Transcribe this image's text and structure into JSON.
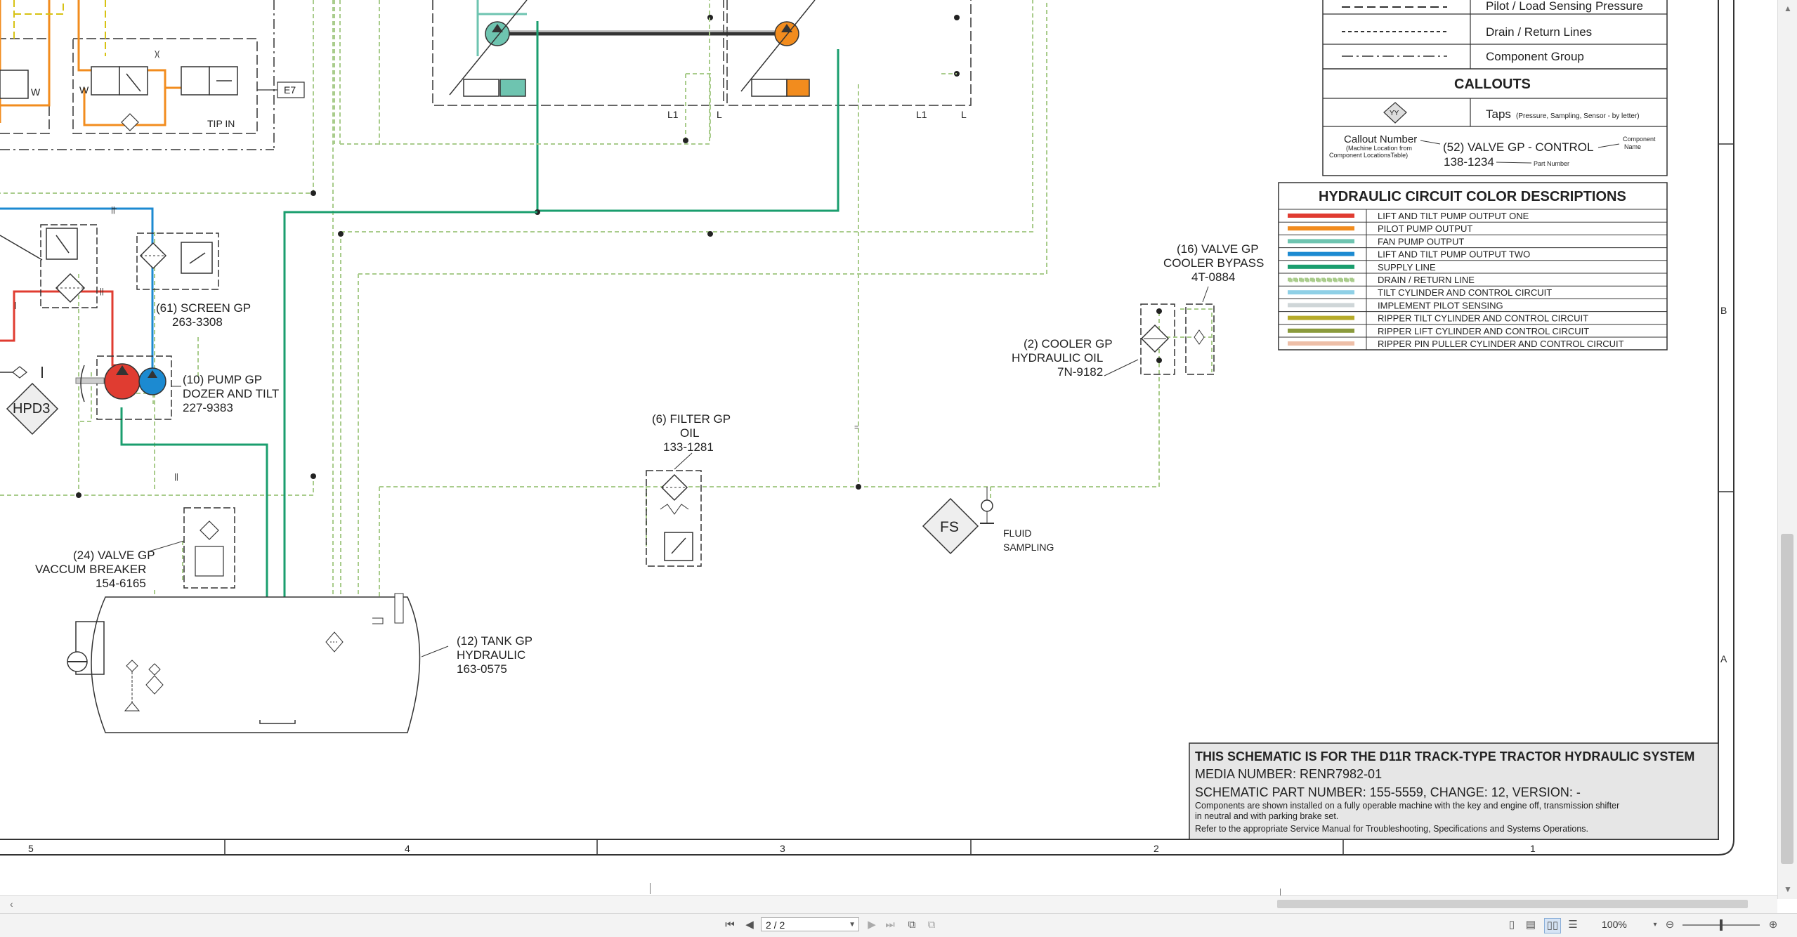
{
  "legend": {
    "line_types": [
      "Pilot / Load Sensing Pressure",
      "Drain / Return Lines",
      "Component Group"
    ],
    "callouts_title": "CALLOUTS",
    "tap_symbol": "YY",
    "taps_label": "Taps",
    "taps_note": "(Pressure, Sampling, Sensor - by letter)",
    "callout_number_label": "Callout Number",
    "callout_number_note": "(Machine Location from",
    "callout_number_note2": "Component LocationsTable)",
    "example_callout": "(52) VALVE GP - CONTROL",
    "component_name_label": "Component",
    "component_name_label2": "Name",
    "example_part": "138-1234",
    "part_number_label": "Part Number"
  },
  "color_legend": {
    "title": "HYDRAULIC CIRCUIT COLOR DESCRIPTIONS",
    "items": [
      {
        "label": "LIFT AND TILT PUMP OUTPUT ONE",
        "color": "#e03c31"
      },
      {
        "label": "PILOT PUMP OUTPUT",
        "color": "#f28c1e"
      },
      {
        "label": "FAN PUMP OUTPUT",
        "color": "#6ec4b0"
      },
      {
        "label": "LIFT AND TILT PUMP OUTPUT TWO",
        "color": "#1c8ad1"
      },
      {
        "label": "SUPPLY LINE",
        "color": "#1a9e6e"
      },
      {
        "label": "DRAIN / RETURN LINE",
        "color": "#a9cc8c"
      },
      {
        "label": "TILT CYLINDER AND CONTROL CIRCUIT",
        "color": "#8fd0e6"
      },
      {
        "label": "IMPLEMENT PILOT SENSING",
        "color": "#cfd6d8"
      },
      {
        "label": "RIPPER TILT CYLINDER AND CONTROL CIRCUIT",
        "color": "#b6ab2a"
      },
      {
        "label": "RIPPER LIFT CYLINDER AND CONTROL CIRCUIT",
        "color": "#8a9a3c"
      },
      {
        "label": "RIPPER PIN PULLER CYLINDER AND CONTROL CIRCUIT",
        "color": "#eebfa8"
      }
    ]
  },
  "components": {
    "valve16": [
      "(16) VALVE GP",
      "COOLER BYPASS",
      "4T-0884"
    ],
    "cooler2": [
      "(2) COOLER GP",
      "HYDRAULIC OIL",
      "7N-9182"
    ],
    "screen61": [
      "(61) SCREEN GP",
      "263-3308"
    ],
    "pump10": [
      "(10) PUMP GP",
      "DOZER AND TILT",
      "227-9383"
    ],
    "filter6": [
      "(6) FILTER GP",
      "OIL",
      "133-1281"
    ],
    "valve24": [
      "(24) VALVE GP",
      "VACCUM BREAKER",
      "154-6165"
    ],
    "tank12": [
      "(12) TANK GP",
      "HYDRAULIC",
      "163-0575"
    ],
    "fluid_sampling": [
      "FLUID",
      "SAMPLING"
    ],
    "tap_hpd3": "HPD3",
    "tap_fs": "FS",
    "port_e7": "E7",
    "tip_in": "TIP IN",
    "port_w": "W",
    "port_l1": "L1",
    "port_l": "L"
  },
  "title_block": {
    "line1": "THIS SCHEMATIC IS FOR THE D11R TRACK-TYPE TRACTOR HYDRAULIC SYSTEM",
    "line2": "MEDIA NUMBER: RENR7982-01",
    "line3": "SCHEMATIC PART NUMBER: 155-5559, CHANGE: 12, VERSION: -",
    "line4": "Components are shown installed on a fully operable machine with the key and engine off, transmission shifter",
    "line5": "in neutral and with parking brake set.",
    "line6": "Refer to the appropriate Service Manual for Troubleshooting, Specifications and Systems Operations."
  },
  "grid": {
    "columns": [
      "5",
      "4",
      "3",
      "2",
      "1"
    ],
    "rows": [
      "B",
      "A"
    ]
  },
  "toolbar": {
    "page_value": "2 / 2",
    "zoom": "100%"
  }
}
